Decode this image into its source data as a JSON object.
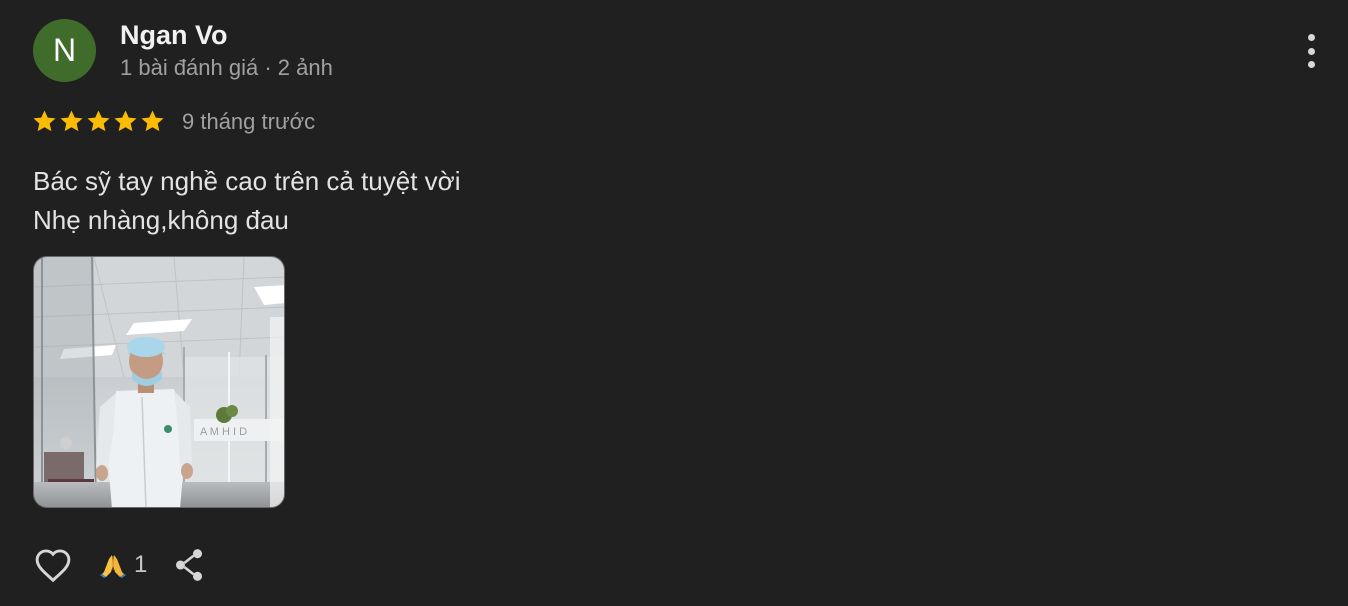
{
  "review": {
    "avatar_initial": "N",
    "author_name": "Ngan Vo",
    "author_meta": "1 bài đánh giá · 2 ảnh",
    "rating": 5,
    "rating_max": 5,
    "time_ago": "9 tháng trước",
    "text_lines": [
      "Bác sỹ tay nghề cao trên cả tuyệt vời",
      "Nhẹ nhàng,không đau"
    ],
    "reaction_emoji": "🙏",
    "reaction_count": "1"
  },
  "icons": {
    "more": "more-vert-icon",
    "like": "heart-outline-icon",
    "reaction": "folded-hands-icon",
    "share": "share-icon",
    "star": "star-icon"
  },
  "colors": {
    "background": "#202020",
    "avatar": "#3f6c2b",
    "star": "#fbbc04",
    "secondary_text": "#a0a0a0"
  }
}
